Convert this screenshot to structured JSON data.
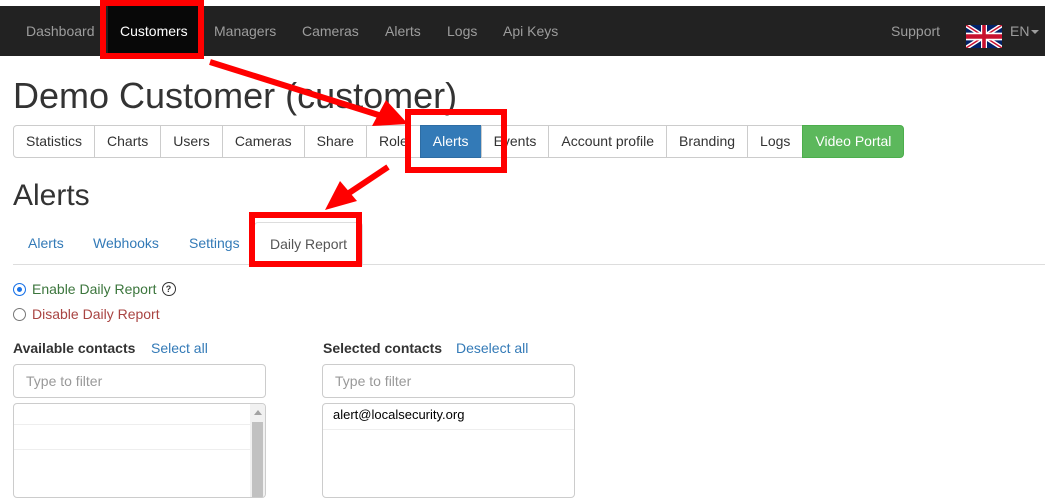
{
  "navbar": {
    "items": [
      "Dashboard",
      "Customers",
      "Managers",
      "Cameras",
      "Alerts",
      "Logs",
      "Api Keys"
    ],
    "active": "Customers",
    "support": "Support",
    "language": "EN"
  },
  "page": {
    "title": "Demo Customer (customer)"
  },
  "tabs": [
    "Statistics",
    "Charts",
    "Users",
    "Cameras",
    "Share",
    "Role",
    "Alerts",
    "Events",
    "Account profile",
    "Branding",
    "Logs",
    "Video Portal"
  ],
  "active_tab": "Alerts",
  "section": {
    "title": "Alerts",
    "subtabs": [
      "Alerts",
      "Webhooks",
      "Settings",
      "Daily Report"
    ],
    "active_subtab": "Daily Report"
  },
  "daily_report": {
    "enable_label": "Enable Daily Report",
    "disable_label": "Disable Daily Report",
    "enabled": true,
    "help_icon": "?"
  },
  "available": {
    "label": "Available contacts",
    "action": "Select all",
    "placeholder": "Type to filter",
    "items": []
  },
  "selected": {
    "label": "Selected contacts",
    "action": "Deselect all",
    "placeholder": "Type to filter",
    "items": [
      "alert@localsecurity.org"
    ]
  },
  "colors": {
    "navbar": "#222222",
    "primary": "#337ab7",
    "success": "#5cb85c",
    "highlight": "#ff0000"
  }
}
